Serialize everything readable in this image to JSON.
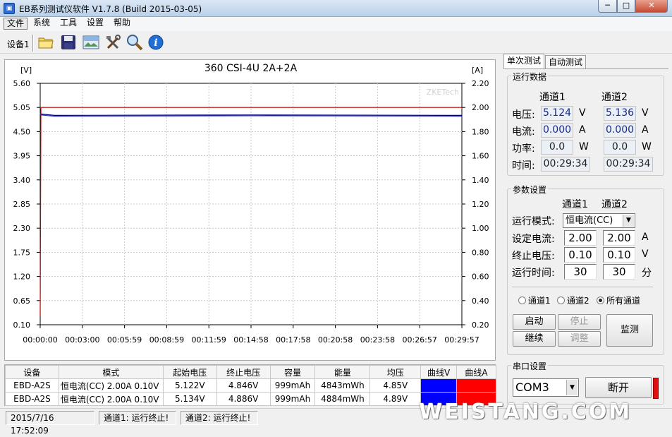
{
  "window": {
    "title": "EB系列测试仪软件 V1.7.8 (Build 2015-03-05)",
    "minimize_glyph": "─",
    "maximize_glyph": "□",
    "close_glyph": "✕"
  },
  "menu": [
    "文件",
    "系统",
    "工具",
    "设置",
    "帮助"
  ],
  "toolbar": {
    "device_label": "设备1",
    "icons": [
      "open-folder-icon",
      "save-disk-icon",
      "image-icon",
      "tools-icon",
      "zoom-icon",
      "info-icon"
    ]
  },
  "chart_data": {
    "type": "line",
    "title": "360 CSI-4U 2A+2A",
    "left_unit": "[V]",
    "right_unit": "[A]",
    "watermark": "ZKETech",
    "y_left_ticks": [
      "5.60",
      "5.05",
      "4.50",
      "3.95",
      "3.40",
      "2.85",
      "2.30",
      "1.75",
      "1.20",
      "0.65",
      "0.10"
    ],
    "y_left_range": [
      0.1,
      5.6
    ],
    "y_right_ticks": [
      "2.20",
      "2.00",
      "1.80",
      "1.60",
      "1.40",
      "1.20",
      "1.00",
      "0.80",
      "0.60",
      "0.40",
      "0.20"
    ],
    "y_right_range": [
      0.2,
      2.2
    ],
    "x_ticks": [
      "00:00:00",
      "00:03:00",
      "00:05:59",
      "00:08:59",
      "00:11:59",
      "00:14:58",
      "00:17:58",
      "00:20:58",
      "00:23:58",
      "00:26:57",
      "00:29:57"
    ],
    "grid": true,
    "series": [
      {
        "color": "#c00000",
        "axis": "left",
        "x": [
          0,
          0.05,
          30
        ],
        "y": [
          0.3,
          5.05,
          5.05
        ]
      },
      {
        "color": "#000080",
        "axis": "left",
        "x": [
          0,
          0.05,
          1.0,
          15,
          30
        ],
        "y": [
          4.93,
          4.9,
          4.87,
          4.88,
          4.87
        ]
      },
      {
        "color": "#3030c0",
        "axis": "left",
        "x": [
          0,
          0.05,
          1.0,
          15,
          30
        ],
        "y": [
          4.92,
          4.88,
          4.85,
          4.86,
          4.85
        ]
      }
    ]
  },
  "table": {
    "headers": [
      "设备",
      "模式",
      "起始电压",
      "终止电压",
      "容量",
      "能量",
      "均压",
      "曲线V",
      "曲线A"
    ],
    "rows": [
      {
        "device": "EBD-A2S",
        "mode": "恒电流(CC)  2.00A  0.10V",
        "start_v": "5.122V",
        "end_v": "4.846V",
        "capacity": "999mAh",
        "energy": "4843mWh",
        "avg_v": "4.85V",
        "curve_v_color": "#0000ff",
        "curve_a_color": "#ff0000"
      },
      {
        "device": "EBD-A2S",
        "mode": "恒电流(CC)  2.00A  0.10V",
        "start_v": "5.134V",
        "end_v": "4.886V",
        "capacity": "999mAh",
        "energy": "4884mWh",
        "avg_v": "4.89V",
        "curve_v_color": "#0000ff",
        "curve_a_color": "#ff0000"
      }
    ]
  },
  "status": {
    "datetime": "2015/7/16 17:52:09",
    "ch1": "通道1: 运行终止!",
    "ch2": "通道2: 运行终止!",
    "watermark": "WEISTANG.COM"
  },
  "tabs": [
    "单次测试",
    "自动测试"
  ],
  "run_data": {
    "title": "运行数据",
    "ch1_header": "通道1",
    "ch2_header": "通道2",
    "rows": [
      {
        "label": "电压:",
        "ch1": "5.124",
        "ch2": "5.136",
        "unit": "V"
      },
      {
        "label": "电流:",
        "ch1": "0.000",
        "ch2": "0.000",
        "unit": "A"
      },
      {
        "label": "功率:",
        "ch1": "0.0",
        "ch2": "0.0",
        "unit": "W"
      },
      {
        "label": "时间:",
        "ch1": "00:29:34",
        "ch2": "00:29:34",
        "unit": ""
      }
    ]
  },
  "params": {
    "title": "参数设置",
    "ch1_header": "通道1",
    "ch2_header": "通道2",
    "mode_label": "运行模式:",
    "mode_value": "恒电流(CC)",
    "current_label": "设定电流:",
    "current_ch1": "2.00",
    "current_ch2": "2.00",
    "current_unit": "A",
    "cutoff_label": "终止电压:",
    "cutoff_ch1": "0.10",
    "cutoff_ch2": "0.10",
    "cutoff_unit": "V",
    "time_label": "运行时间:",
    "time_ch1": "30",
    "time_ch2": "30",
    "time_unit": "分",
    "radio_ch1": "通道1",
    "radio_ch2": "通道2",
    "radio_all": "所有通道",
    "selected_radio": "所有通道",
    "btn_start": "启动",
    "btn_stop": "停止",
    "btn_continue": "继续",
    "btn_adjust": "调整",
    "btn_monitor": "监测"
  },
  "serial": {
    "title": "串口设置",
    "port": "COM3",
    "btn_disconnect": "断开",
    "indicator_color": "#e01010"
  }
}
